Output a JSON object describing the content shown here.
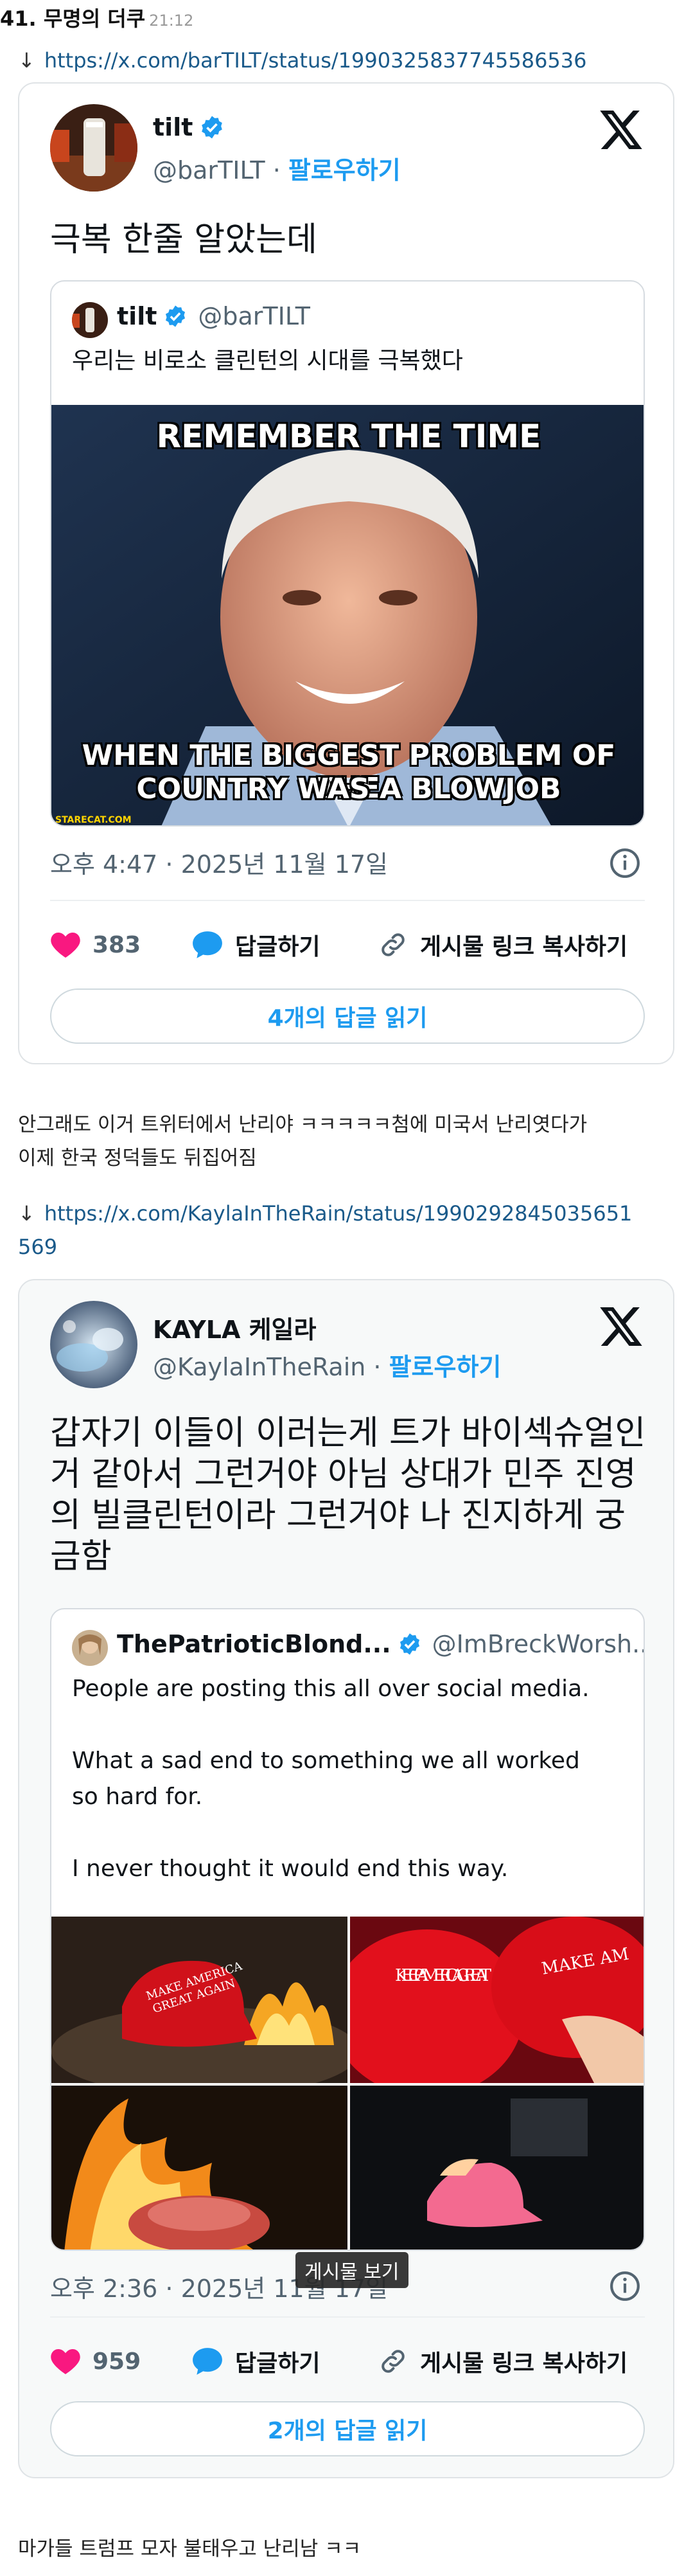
{
  "post": {
    "title": "41. 무명의 더쿠",
    "time": "21:12"
  },
  "tweets": [
    {
      "link_arrow": "↓",
      "link": "https://x.com/barTILT/status/1990325837745586536",
      "author": {
        "name": "tilt",
        "handle": "@barTILT",
        "follow": "팔로우하기",
        "separator": " · "
      },
      "text": "극복 한줄 알았는데",
      "quote": {
        "name": "tilt",
        "handle": "@barTILT",
        "text": "우리는 비로소 클린턴의 시대를 극복했다",
        "meme_top": "REMEMBER THE TIME",
        "meme_bottom_1": "WHEN THE BIGGEST PROBLEM OF THE",
        "meme_bottom_2": "COUNTRY WAS A BLOWJOB",
        "watermark": "STARECAT.COM"
      },
      "timestamp": "오후 4:47 · 2025년 11월 17일",
      "likes": "383",
      "reply_label": "답글하기",
      "copy_label": "게시물 링크 복사하기",
      "read_replies": "4개의 답글 읽기"
    },
    {
      "link_arrow": "↓",
      "link_line1": "https://x.com/KaylaInTheRain/status/1990292845035651",
      "link_line2": "569",
      "author": {
        "name": "KAYLA 케일라",
        "handle": "@KaylaInTheRain",
        "follow": "팔로우하기",
        "separator": " · "
      },
      "text_lines": [
        "갑자기 이들이 이러는게 트가 바이섹슈얼인",
        "거 같아서 그런거야 아님 상대가 민주 진영",
        "의 빌클린턴이라 그런거야 나 진지하게 궁",
        "금함"
      ],
      "quote": {
        "name": "ThePatrioticBlond...",
        "handle": "@ImBreckWorsh...",
        "para1": "People are posting this all over social media.",
        "para2_line1": "What a sad end to something we all worked",
        "para2_line2": "so hard for.",
        "para3": "I never thought it would end this way.",
        "hat_text_1": "MAKE AMERICA",
        "hat_text_2": "GREAT AGAIN",
        "hat2_text": "KEEP AMERICA GREAT",
        "hat3_text": "MAKE AM"
      },
      "timestamp": "오후 2:36 · 2025년 11월 17일",
      "tooltip": "게시물 보기",
      "likes": "959",
      "reply_label": "답글하기",
      "copy_label": "게시물 링크 복사하기",
      "read_replies": "2개의 답글 읽기"
    }
  ],
  "body": {
    "para1_line1": "안그래도 이거 트위터에서 난리야 ㅋㅋㅋㅋㅋ첨에 미국서 난리엿다가",
    "para1_line2": "이제 한국 정덕들도 뒤집어짐",
    "para2": "마가들 트럼프 모자 불태우고 난리남 ㅋㅋ"
  },
  "colors": {
    "accent": "#1d9bf0",
    "heart": "#f91880",
    "link": "#1a5a8a"
  }
}
